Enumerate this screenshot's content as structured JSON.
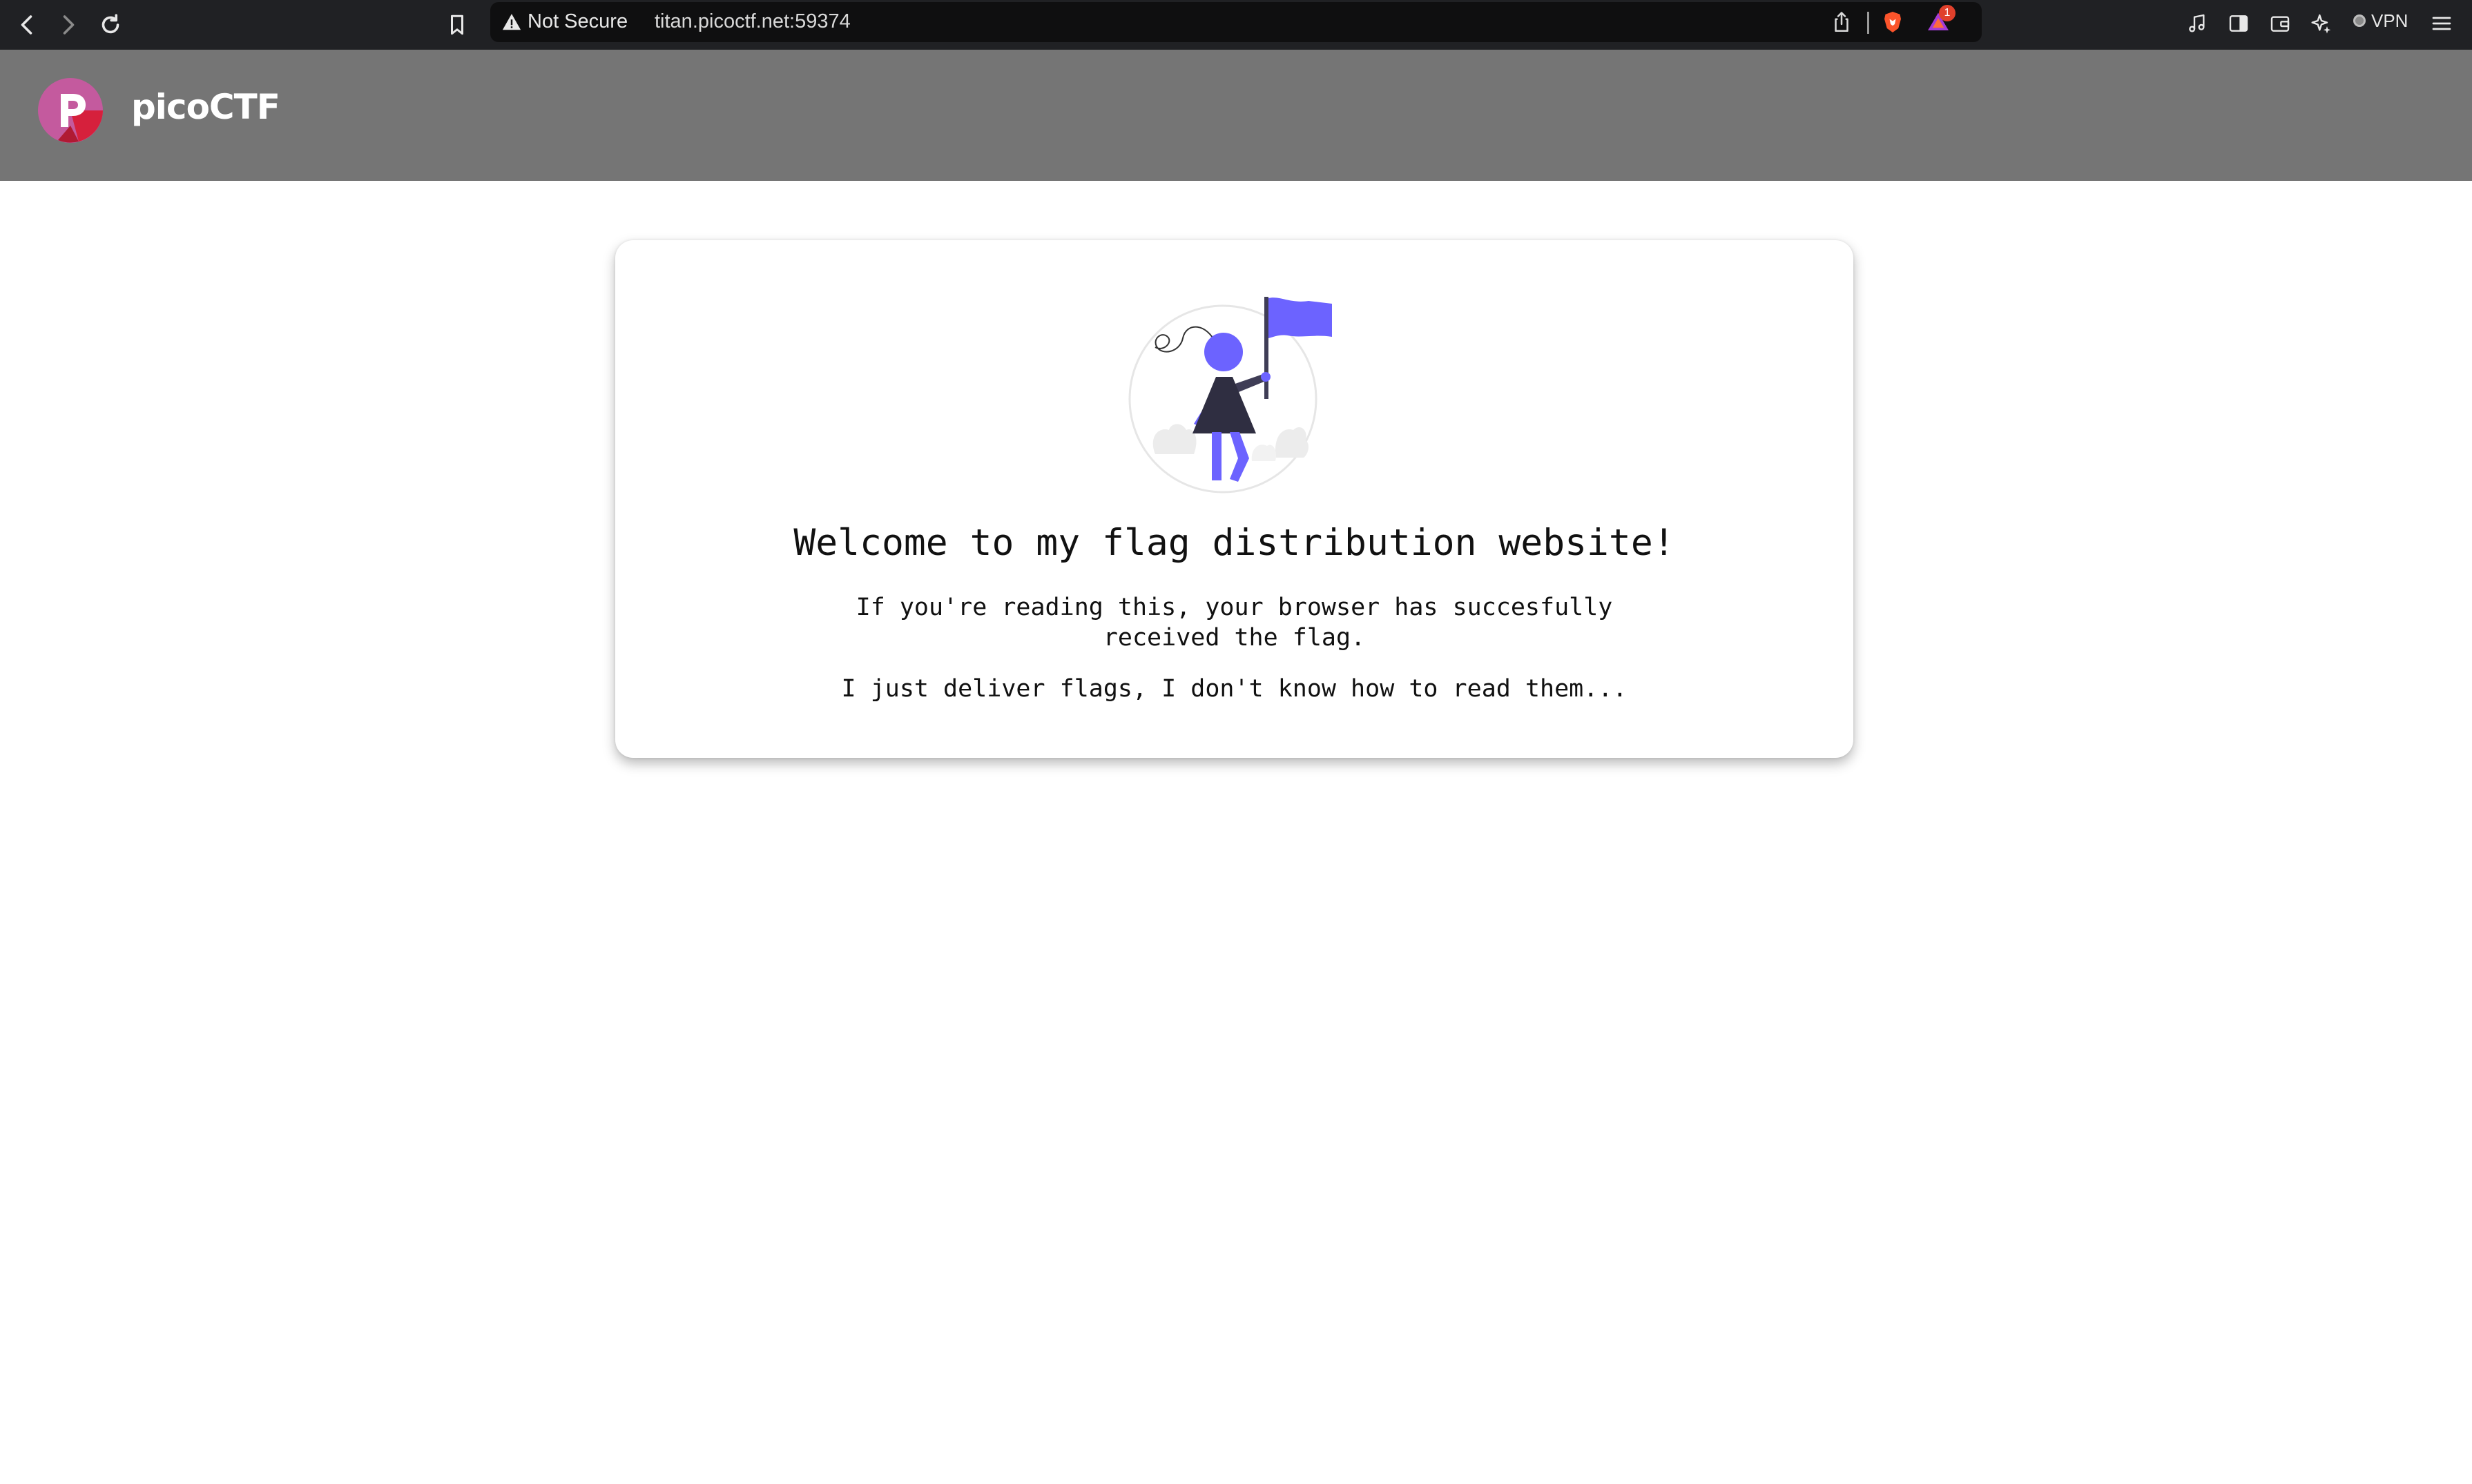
{
  "browser": {
    "security_label": "Not Secure",
    "url": "titan.picoctf.net:59374",
    "notification_count": "1",
    "vpn_label": "VPN"
  },
  "site": {
    "brand": "picoCTF",
    "colors": {
      "header_bg": "#757575",
      "accent": "#6c63ff",
      "logo_pink": "#c45a9e",
      "logo_red": "#d6203c"
    }
  },
  "card": {
    "heading": "Welcome to my flag distribution website!",
    "message_line1": "If you're reading this, your browser has succesfully",
    "message_line2": "received the flag.",
    "footer_text": "I just deliver flags, I don't know how to read them..."
  },
  "icons": {
    "back": "chevron-left-icon",
    "forward": "chevron-right-icon",
    "reload": "reload-icon",
    "bookmark": "bookmark-icon",
    "warning": "warning-triangle-icon",
    "share": "share-icon",
    "brave_shield": "brave-shield-icon",
    "rewards": "rewards-triangle-icon",
    "music": "music-note-icon",
    "sidebar": "sidebar-icon",
    "wallet": "wallet-icon",
    "leo": "leo-sparkle-icon",
    "menu": "hamburger-menu-icon"
  }
}
